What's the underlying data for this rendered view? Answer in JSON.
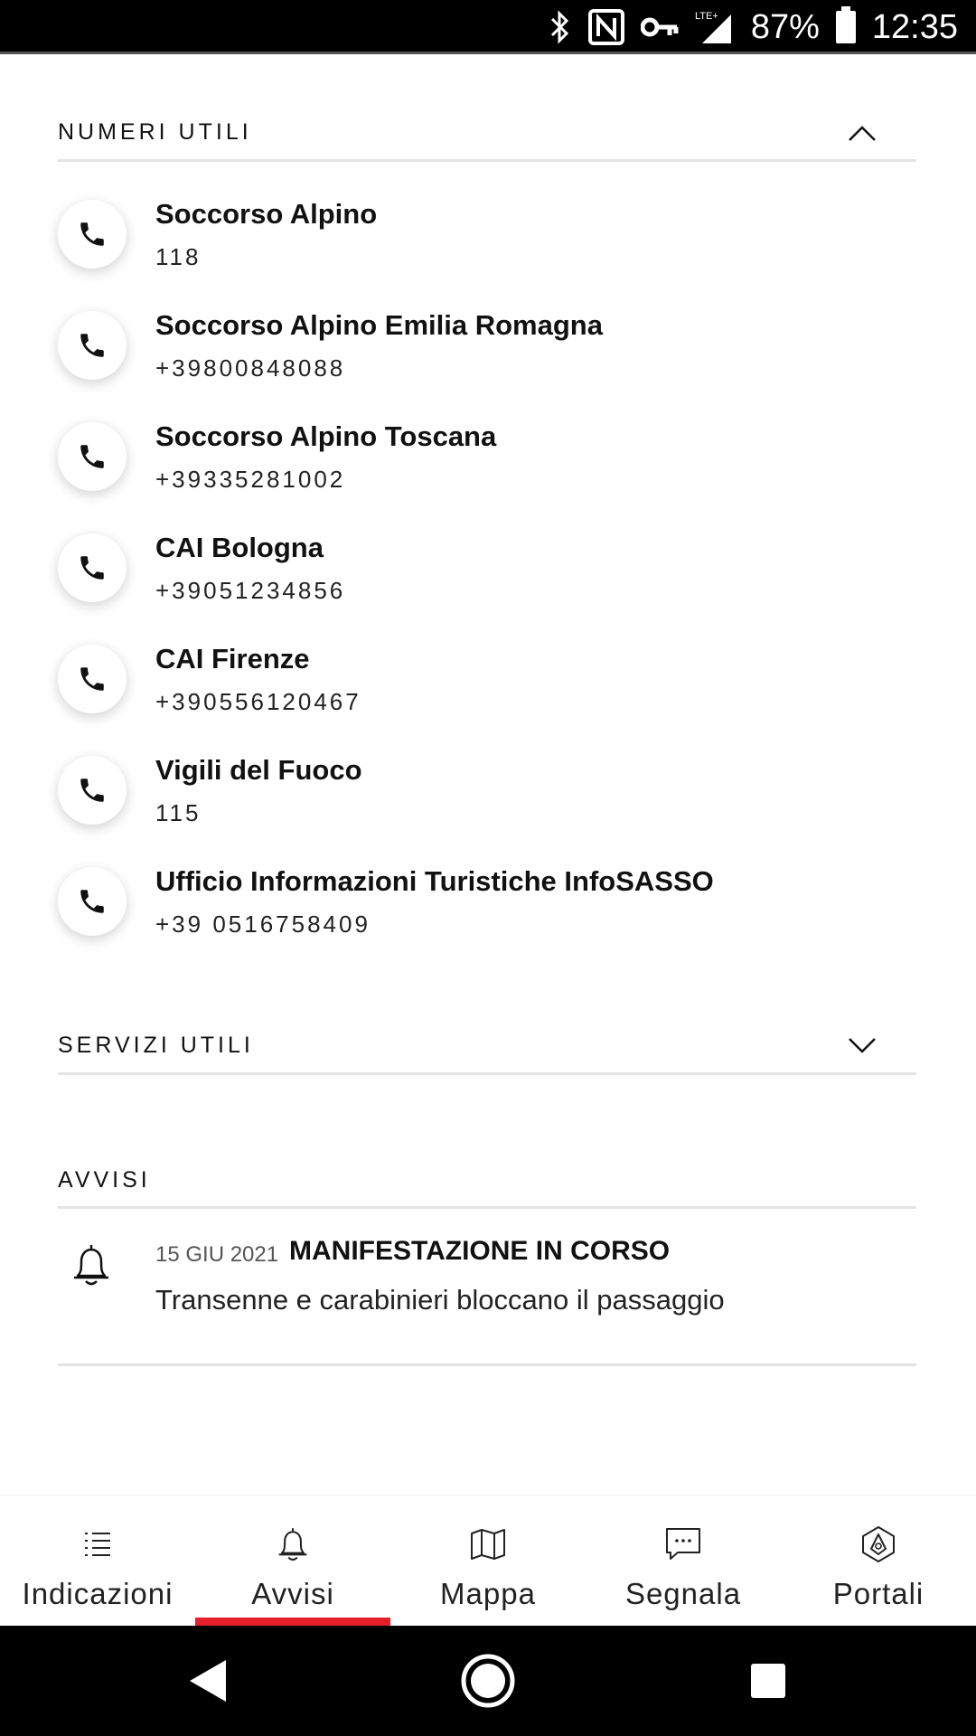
{
  "status_bar": {
    "battery_percent": "87%",
    "time": "12:35",
    "network": "LTE+"
  },
  "numeri_utili": {
    "title": "NUMERI UTILI",
    "expanded": true,
    "contacts": [
      {
        "name": "Soccorso Alpino",
        "number": "118"
      },
      {
        "name": "Soccorso Alpino Emilia Romagna",
        "number": "+39800848088"
      },
      {
        "name": "Soccorso Alpino Toscana",
        "number": "+39335281002"
      },
      {
        "name": "CAI Bologna",
        "number": "+39051234856"
      },
      {
        "name": "CAI Firenze",
        "number": "+390556120467"
      },
      {
        "name": "Vigili del Fuoco",
        "number": "115"
      },
      {
        "name": "Ufficio Informazioni Turistiche InfoSASSO",
        "number": "+39 0516758409"
      }
    ]
  },
  "servizi_utili": {
    "title": "SERVIZI UTILI",
    "expanded": false
  },
  "avvisi": {
    "title": "AVVISI",
    "items": [
      {
        "date": "15 GIU 2021",
        "title": "MANIFESTAZIONE IN CORSO",
        "body": "Transenne e carabinieri bloccano il passaggio"
      }
    ]
  },
  "bottom_nav": {
    "active": "Avvisi",
    "accent_color": "#e5202b",
    "items": [
      {
        "label": "Indicazioni",
        "icon": "list-icon"
      },
      {
        "label": "Avvisi",
        "icon": "bell-icon"
      },
      {
        "label": "Mappa",
        "icon": "map-icon"
      },
      {
        "label": "Segnala",
        "icon": "message-icon"
      },
      {
        "label": "Portali",
        "icon": "portal-icon"
      }
    ]
  }
}
